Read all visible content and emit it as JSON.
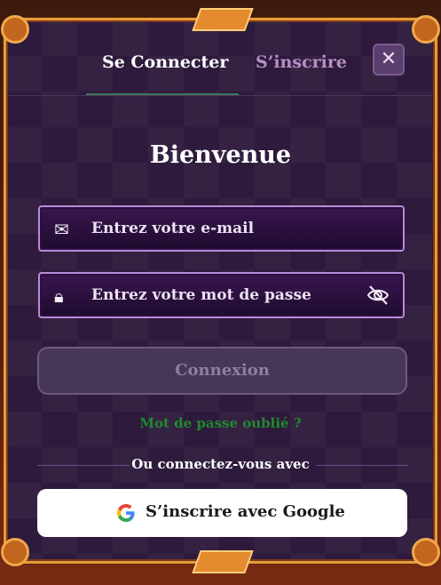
{
  "tabs": {
    "login": "Se Connecter",
    "register": "S’inscrire"
  },
  "close_icon": "close-icon",
  "title": "Bienvenue",
  "email": {
    "placeholder": "Entrez votre e-mail",
    "icon": "envelope-icon"
  },
  "password": {
    "placeholder": "Entrez votre mot de passe",
    "icon": "lock-icon",
    "toggle_icon": "eye-off-icon"
  },
  "login_button": "Connexion",
  "forgot": "Mot de passe oublié ?",
  "or_text": "Ou connectez-vous avec",
  "google_button": "S’inscrire avec Google",
  "colors": {
    "frame": "#e89a3a",
    "panel": "#2e1a3c",
    "forgot": "#1f8a2e",
    "google_bg": "#ffffff"
  }
}
